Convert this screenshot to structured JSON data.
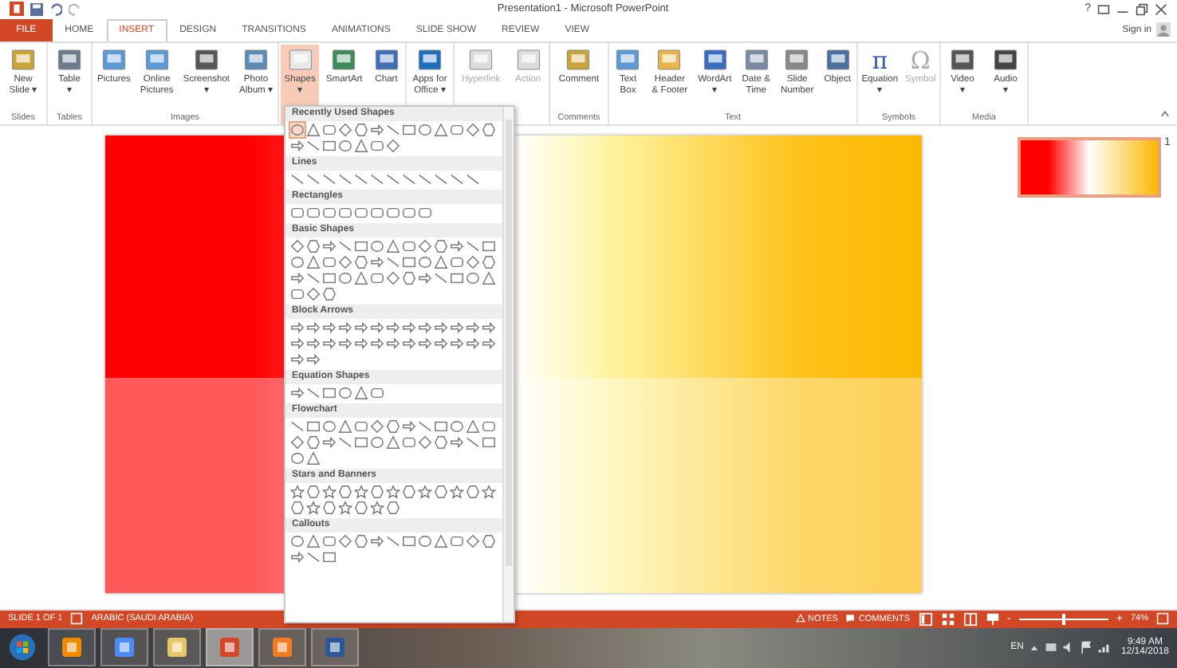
{
  "title_bar": {
    "title": "Presentation1 - Microsoft PowerPoint",
    "help": "?",
    "sign_in": "Sign in"
  },
  "file_tab": {
    "label": "FILE"
  },
  "tabs": [
    {
      "label": "HOME",
      "selected": false
    },
    {
      "label": "INSERT",
      "selected": true
    },
    {
      "label": "DESIGN",
      "selected": false
    },
    {
      "label": "TRANSITIONS",
      "selected": false
    },
    {
      "label": "ANIMATIONS",
      "selected": false
    },
    {
      "label": "SLIDE SHOW",
      "selected": false
    },
    {
      "label": "REVIEW",
      "selected": false
    },
    {
      "label": "VIEW",
      "selected": false
    }
  ],
  "ribbon_groups": [
    {
      "label": "Slides",
      "buttons": [
        {
          "label": "New\nSlide ▾",
          "disabled": false,
          "selected": false
        }
      ]
    },
    {
      "label": "Tables",
      "buttons": [
        {
          "label": "Table\n▾",
          "disabled": false,
          "selected": false
        }
      ]
    },
    {
      "label": "Images",
      "buttons": [
        {
          "label": "Pictures",
          "disabled": false,
          "selected": false
        },
        {
          "label": "Online\nPictures",
          "disabled": false,
          "selected": false
        },
        {
          "label": "Screenshot\n▾",
          "disabled": false,
          "selected": false
        },
        {
          "label": "Photo\nAlbum ▾",
          "disabled": false,
          "selected": false
        }
      ]
    },
    {
      "buttons": [
        {
          "label": "Shapes\n▾",
          "disabled": false,
          "selected": true
        },
        {
          "label": "SmartArt",
          "disabled": false,
          "selected": false
        },
        {
          "label": "Chart",
          "disabled": false,
          "selected": false
        }
      ]
    },
    {
      "buttons": [
        {
          "label": "Apps for\nOffice ▾",
          "disabled": false,
          "selected": false
        }
      ]
    },
    {
      "buttons": [
        {
          "label": "Hyperlink",
          "disabled": true,
          "selected": false
        },
        {
          "label": "Action",
          "disabled": true,
          "selected": false
        }
      ]
    },
    {
      "label": "Comments",
      "buttons": [
        {
          "label": "Comment",
          "disabled": false,
          "selected": false
        }
      ]
    },
    {
      "label": "Text",
      "buttons": [
        {
          "label": "Text\nBox",
          "disabled": false,
          "selected": false
        },
        {
          "label": "Header\n& Footer",
          "disabled": false,
          "selected": false
        },
        {
          "label": "WordArt\n▾",
          "disabled": false,
          "selected": false
        },
        {
          "label": "Date &\nTime",
          "disabled": false,
          "selected": false
        },
        {
          "label": "Slide\nNumber",
          "disabled": false,
          "selected": false
        },
        {
          "label": "Object",
          "disabled": false,
          "selected": false
        }
      ]
    },
    {
      "label": "Symbols",
      "buttons": [
        {
          "label": "Equation\n▾",
          "glyph": "π",
          "disabled": false,
          "selected": false
        },
        {
          "label": "Symbol",
          "glyph": "Ω",
          "disabled": true,
          "selected": false
        }
      ]
    },
    {
      "label": "Media",
      "buttons": [
        {
          "label": "Video\n▾",
          "disabled": false,
          "selected": false
        },
        {
          "label": "Audio\n▾",
          "disabled": false,
          "selected": false
        }
      ]
    }
  ],
  "shapes_menu": {
    "sections": [
      {
        "title": "Recently Used Shapes"
      },
      {
        "title": "Lines"
      },
      {
        "title": "Rectangles"
      },
      {
        "title": "Basic Shapes"
      },
      {
        "title": "Block Arrows"
      },
      {
        "title": "Equation Shapes"
      },
      {
        "title": "Flowchart"
      },
      {
        "title": "Stars and Banners"
      },
      {
        "title": "Callouts"
      }
    ]
  },
  "thumbnail": {
    "number": "1"
  },
  "status_bar": {
    "slide": "SLIDE 1 OF 1",
    "language": "ARABIC (SAUDI ARABIA)",
    "notes": "NOTES",
    "comments": "COMMENTS",
    "zoom": {
      "out": "-",
      "in": "+",
      "level": 0.5,
      "reading": "74%"
    }
  },
  "taskbar": {
    "apps": [
      {
        "selected": false
      },
      {
        "selected": false
      },
      {
        "selected": false
      },
      {
        "selected": true
      },
      {
        "selected": false
      },
      {
        "selected": false
      }
    ],
    "language": "EN",
    "time": "9:49 AM",
    "date": "12/14/2018"
  }
}
